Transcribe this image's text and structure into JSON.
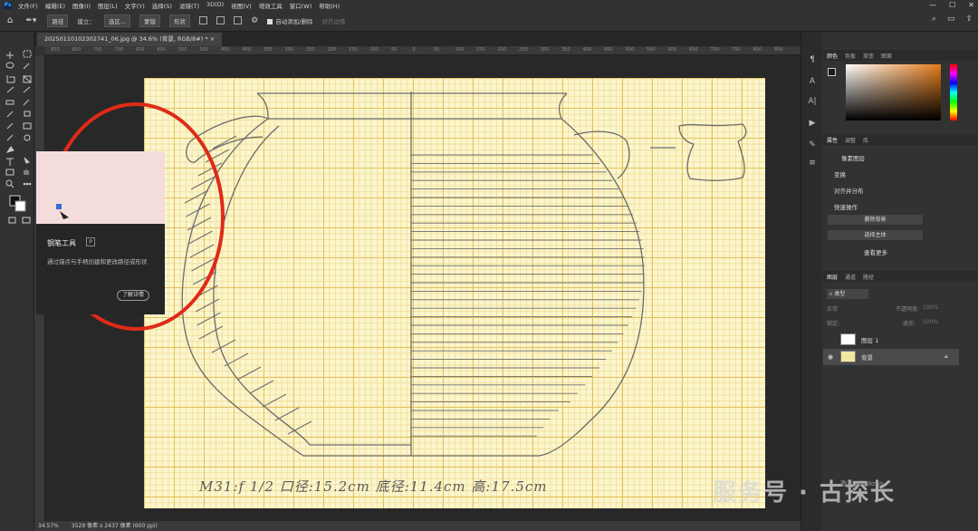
{
  "menubar": {
    "logo": "Ps",
    "items": [
      "文件(F)",
      "编辑(E)",
      "图像(I)",
      "图层(L)",
      "文字(Y)",
      "选择(S)",
      "滤镜(T)",
      "3D(D)",
      "视图(V)",
      "增效工具",
      "窗口(W)",
      "帮助(H)"
    ]
  },
  "optionsbar": {
    "mode": "路径",
    "build": "建立：",
    "selection": "选区...",
    "mask": "蒙版",
    "shape": "形状",
    "auto_add_delete": "自动添加/删除",
    "align_edges": "对齐边缘"
  },
  "document": {
    "tab_title": "20250110102302741_06.jpg @ 34.6% (背景, RGB/8#) *",
    "ruler_ticks": [
      "850",
      "800",
      "750",
      "700",
      "650",
      "600",
      "550",
      "500",
      "450",
      "400",
      "350",
      "300",
      "250",
      "200",
      "150",
      "100",
      "50",
      "0",
      "50",
      "100",
      "150",
      "200",
      "250",
      "300",
      "350",
      "400",
      "450",
      "500",
      "550",
      "600",
      "650",
      "700",
      "750",
      "800",
      "850"
    ],
    "caption": "M31:f  1/2  口径:15.2cm  底径:11.4cm  高:17.5cm"
  },
  "statusbar": {
    "zoom": "34.57%",
    "info": "3529 像素 x 2437 像素 (600 ppi)"
  },
  "tooltip": {
    "title": "钢笔工具",
    "shortcut": "P",
    "description": "通过锚点与手柄创建和更改路径或形状",
    "learn_more": "了解详情"
  },
  "panels": {
    "color_tabs": [
      "颜色",
      "色板",
      "渐变",
      "图案"
    ],
    "props_tabs": [
      "属性",
      "调整",
      "库"
    ],
    "pixel_layer": "像素图层",
    "transform": "变换",
    "align": "对齐并分布",
    "quick_actions": "快速操作",
    "remove_bg": "删除背景",
    "select_subject": "选择主体",
    "view_more": "查看更多",
    "layers_tabs": [
      "图层",
      "通道",
      "路径"
    ],
    "filter_kind": "类型",
    "blend_mode": "正常",
    "opacity_label": "不透明度:",
    "opacity_value": "100%",
    "lock_label": "锁定:",
    "fill_label": "填充:",
    "fill_value": "100%",
    "layers": [
      {
        "name": "图层 1",
        "visible": false
      },
      {
        "name": "背景",
        "visible": true
      }
    ]
  },
  "watermark": {
    "text": "服务号 · 古探长",
    "win_activate": "激活 Windows"
  },
  "colors": {
    "paper": "#fbf6cc",
    "grid": "#e5c15e",
    "circle": "#e02a18",
    "ui_bg": "#323232"
  }
}
